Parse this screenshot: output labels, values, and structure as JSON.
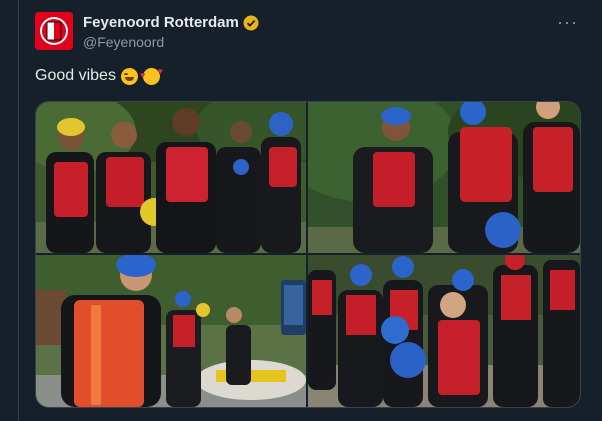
{
  "account": {
    "display_name": "Feyenoord Rotterdam",
    "handle": "@Feyenoord",
    "verified": true,
    "avatar_icon": "feyenoord-crest-icon"
  },
  "menu": {
    "more_label": "···"
  },
  "tweet": {
    "text": "Good vibes",
    "emojis": [
      "grinning-squinting-face",
      "smiling-face-with-hearts"
    ]
  },
  "media": {
    "count": 4,
    "photos": [
      {
        "id": "photo-1",
        "subject": "group-of-players-rafting-gear"
      },
      {
        "id": "photo-2",
        "subject": "players-with-blue-helmets"
      },
      {
        "id": "photo-3",
        "subject": "player-in-blue-helmet-closeup"
      },
      {
        "id": "photo-4",
        "subject": "group-with-helmets-on-rocks"
      }
    ]
  },
  "colors": {
    "background": "#15202b",
    "border": "#38444d",
    "text": "#e7e9ea",
    "muted": "#8b98a5",
    "verified": "#e8b41a",
    "brand_red": "#e3001b"
  }
}
